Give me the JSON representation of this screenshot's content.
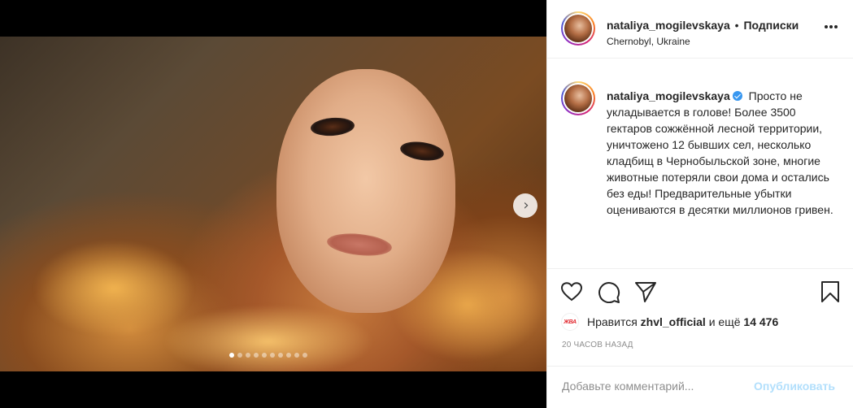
{
  "post": {
    "username": "nataliya_mogilevskaya",
    "separator": "•",
    "follow_label": "Подписки",
    "location": "Chernobyl, Ukraine",
    "caption": "Просто не укладывается в голове! Более 3500 гектаров сожжённой лесной территории, уничтожено 12 бывших сел, несколько кладбищ в Чернобыльской зоне, многие животные потеряли свои дома и остались без еды! Предварительные убытки оцениваются в десятки миллионов гривен.",
    "carousel": {
      "total": 10,
      "current": 1
    }
  },
  "likes": {
    "liker_avatar_text": "ЖВА",
    "prefix": "Нравится",
    "liker": "zhvl_official",
    "middle": "и ещё",
    "count": "14 476"
  },
  "timestamp": "20 ЧАСОВ НАЗАД",
  "comment": {
    "placeholder": "Добавьте комментарий...",
    "publish_label": "Опубликовать"
  },
  "icons": {
    "more": "more-options-icon",
    "like": "heart-icon",
    "comment": "comment-icon",
    "share": "paper-plane-icon",
    "save": "bookmark-icon",
    "next": "chevron-right-icon",
    "verified": "verified-badge-icon"
  },
  "colors": {
    "verified": "#3897f0",
    "publish_disabled": "#b2dffc",
    "meta_gray": "#8e8e8e"
  }
}
